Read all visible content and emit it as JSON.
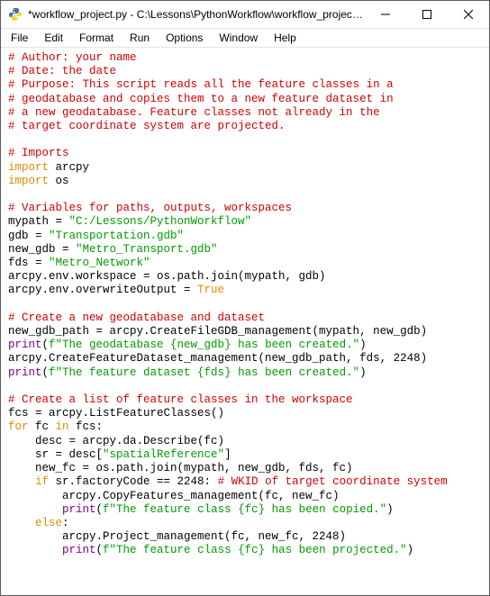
{
  "titlebar": {
    "title": "*workflow_project.py - C:\\Lessons\\PythonWorkflow\\workflow_project...."
  },
  "menubar": {
    "items": [
      {
        "label": "File"
      },
      {
        "label": "Edit"
      },
      {
        "label": "Format"
      },
      {
        "label": "Run"
      },
      {
        "label": "Options"
      },
      {
        "label": "Window"
      },
      {
        "label": "Help"
      }
    ]
  },
  "code": {
    "l0": "# Author: your name",
    "l1": "# Date: the date",
    "l2": "# Purpose: This script reads all the feature classes in a",
    "l3": "# geodatabase and copies them to a new feature dataset in",
    "l4": "# a new geodatabase. Feature classes not already in the",
    "l5": "# target coordinate system are projected.",
    "l6": "",
    "l7": "# Imports",
    "l8a": "import",
    "l8b": " arcpy",
    "l9a": "import",
    "l9b": " os",
    "l10": "",
    "l11": "# Variables for paths, outputs, workspaces",
    "l12a": "mypath = ",
    "l12b": "\"C:/Lessons/PythonWorkflow\"",
    "l13a": "gdb = ",
    "l13b": "\"Transportation.gdb\"",
    "l14a": "new_gdb = ",
    "l14b": "\"Metro_Transport.gdb\"",
    "l15a": "fds = ",
    "l15b": "\"Metro_Network\"",
    "l16": "arcpy.env.workspace = os.path.join(mypath, gdb)",
    "l17a": "arcpy.env.overwriteOutput = ",
    "l17b": "True",
    "l18": "",
    "l19": "# Create a new geodatabase and dataset",
    "l20": "new_gdb_path = arcpy.CreateFileGDB_management(mypath, new_gdb)",
    "l21a": "print",
    "l21b": "(",
    "l21c": "f\"The geodatabase {new_gdb} has been created.\"",
    "l21d": ")",
    "l22": "arcpy.CreateFeatureDataset_management(new_gdb_path, fds, 2248)",
    "l23a": "print",
    "l23b": "(",
    "l23c": "f\"The feature dataset {fds} has been created.\"",
    "l23d": ")",
    "l24": "",
    "l25": "# Create a list of feature classes in the workspace",
    "l26": "fcs = arcpy.ListFeatureClasses()",
    "l27a": "for",
    "l27b": " fc ",
    "l27c": "in",
    "l27d": " fcs:",
    "l28": "    desc = arcpy.da.Describe(fc)",
    "l29a": "    sr = desc[",
    "l29b": "\"spatialReference\"",
    "l29c": "]",
    "l30": "    new_fc = os.path.join(mypath, new_gdb, fds, fc)",
    "l31a": "    ",
    "l31b": "if",
    "l31c": " sr.factoryCode == 2248: ",
    "l31d": "# WKID of target coordinate system",
    "l32": "        arcpy.CopyFeatures_management(fc, new_fc)",
    "l33a": "        ",
    "l33b": "print",
    "l33c": "(",
    "l33d": "f\"The feature class {fc} has been copied.\"",
    "l33e": ")",
    "l34a": "    ",
    "l34b": "else",
    "l34c": ":",
    "l35": "        arcpy.Project_management(fc, new_fc, 2248)",
    "l36a": "        ",
    "l36b": "print",
    "l36c": "(",
    "l36d": "f\"The feature class {fc} has been projected.\"",
    "l36e": ")"
  }
}
